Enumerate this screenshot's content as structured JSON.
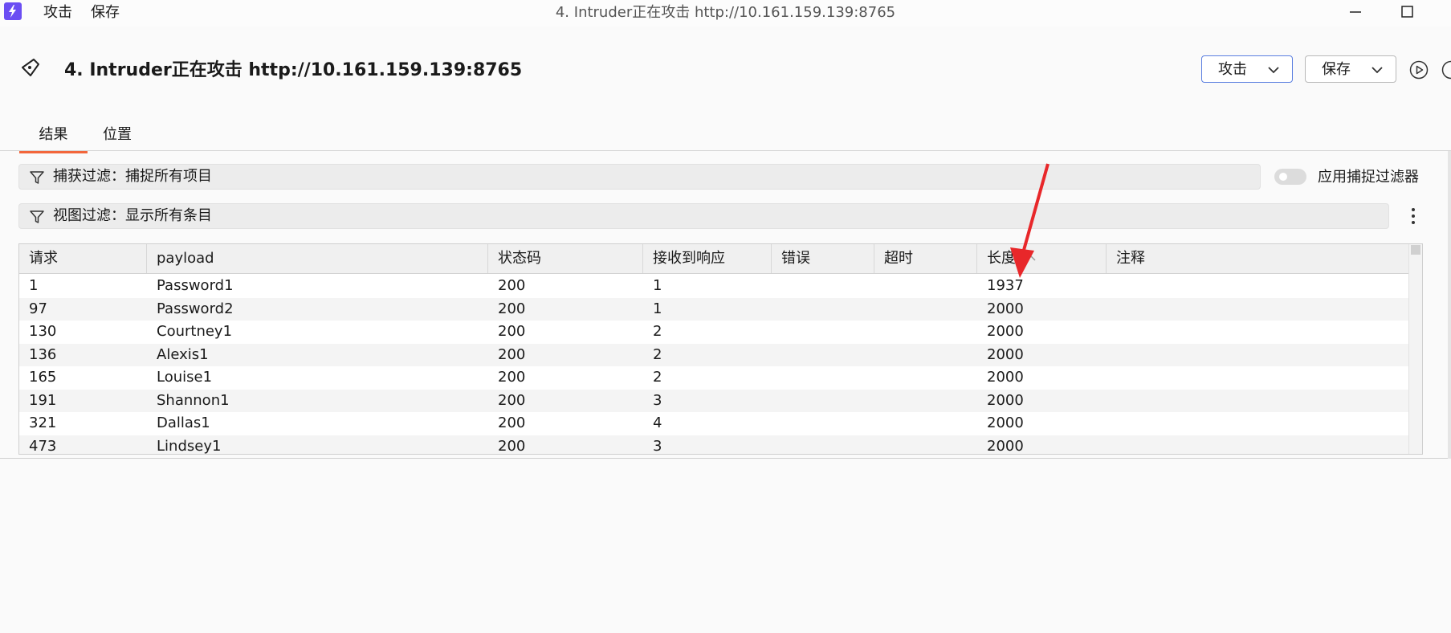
{
  "titlebar": {
    "menu": [
      "攻击",
      "保存"
    ],
    "window_title": "4. Intruder正在攻击 http://10.161.159.139:8765"
  },
  "header": {
    "title": "4. Intruder正在攻击 http://10.161.159.139:8765",
    "attack_label": "攻击",
    "save_label": "保存"
  },
  "tabs": [
    {
      "label": "结果",
      "active": true
    },
    {
      "label": "位置",
      "active": false
    }
  ],
  "filters": {
    "capture": "捕获过滤：捕捉所有项目",
    "view": "视图过滤：显示所有条目",
    "apply_capture_toggle": "应用捕捉过滤器"
  },
  "table": {
    "columns": [
      "请求",
      "payload",
      "状态码",
      "接收到响应",
      "错误",
      "超时",
      "长度",
      "注释"
    ],
    "sorted_column": "长度",
    "sort_direction": "ascending",
    "rows": [
      [
        "1",
        "Password1",
        "200",
        "1",
        "",
        "",
        "1937",
        ""
      ],
      [
        "97",
        "Password2",
        "200",
        "1",
        "",
        "",
        "2000",
        ""
      ],
      [
        "130",
        "Courtney1",
        "200",
        "2",
        "",
        "",
        "2000",
        ""
      ],
      [
        "136",
        "Alexis1",
        "200",
        "2",
        "",
        "",
        "2000",
        ""
      ],
      [
        "165",
        "Louise1",
        "200",
        "2",
        "",
        "",
        "2000",
        ""
      ],
      [
        "191",
        "Shannon1",
        "200",
        "3",
        "",
        "",
        "2000",
        ""
      ],
      [
        "321",
        "Dallas1",
        "200",
        "4",
        "",
        "",
        "2000",
        ""
      ],
      [
        "473",
        "Lindsey1",
        "200",
        "3",
        "",
        "",
        "2000",
        ""
      ]
    ]
  },
  "colors": {
    "accent_tab": "#f2663b",
    "app_icon": "#6b4ef3",
    "annotation_arrow": "#e8272a"
  }
}
